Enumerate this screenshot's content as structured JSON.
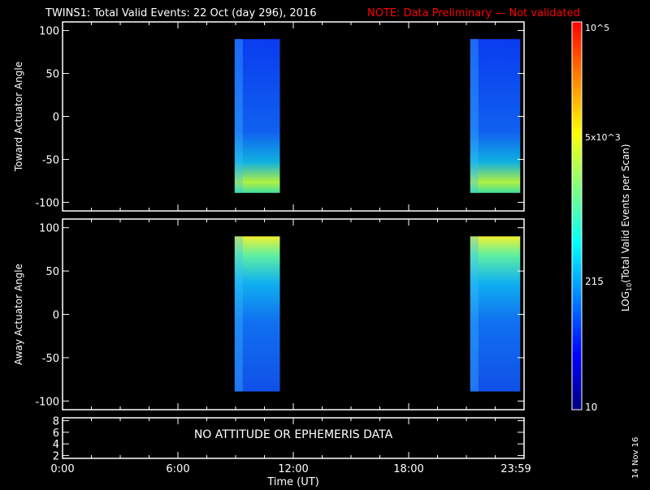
{
  "title": "TWINS1: Total Valid Events: 22 Oct (day 296), 2016",
  "note": "NOTE: Data Preliminary — Not validated",
  "date_stamp": "14 Nov 16",
  "chart_data": [
    {
      "type": "heatmap",
      "ylabel": "Toward Actuator Angle",
      "ylim": [
        -110,
        110
      ],
      "yticks": [
        "100",
        "50",
        "0",
        "-50",
        "-100"
      ],
      "ytick_values": [
        100,
        50,
        0,
        -50,
        -100
      ],
      "blocks": [
        {
          "t0": 8.95,
          "t1": 11.3,
          "a0": -89,
          "a1": 90,
          "profile": "bottom-bright"
        },
        {
          "t0": 21.2,
          "t1": 23.8,
          "a0": -89,
          "a1": 90,
          "profile": "bottom-bright"
        }
      ]
    },
    {
      "type": "heatmap",
      "ylabel": "Away Actuator Angle",
      "ylim": [
        -110,
        110
      ],
      "yticks": [
        "100",
        "50",
        "0",
        "-50",
        "-100"
      ],
      "ytick_values": [
        100,
        50,
        0,
        -50,
        -100
      ],
      "blocks": [
        {
          "t0": 8.95,
          "t1": 11.3,
          "a0": -89,
          "a1": 90,
          "profile": "top-bright"
        },
        {
          "t0": 21.2,
          "t1": 23.8,
          "a0": -89,
          "a1": 90,
          "profile": "top-bright"
        }
      ]
    },
    {
      "type": "text-panel",
      "ylim": [
        1.5,
        8.5
      ],
      "yticks": [
        "8",
        "6",
        "4",
        "2"
      ],
      "ytick_values": [
        8,
        6,
        4,
        2
      ],
      "message": "NO ATTITUDE OR EPHEMERIS DATA"
    }
  ],
  "xaxis": {
    "label": "Time (UT)",
    "ticks": [
      "0:00",
      "6:00",
      "12:00",
      "18:00",
      "23:59"
    ],
    "tick_values": [
      0,
      6,
      12,
      18,
      23.98
    ],
    "xlim": [
      0,
      24
    ]
  },
  "colorbar": {
    "label": "LOG10(Total Valid Events per Scan)",
    "label_main": "LOG",
    "label_sub": "10",
    "label_rest": "(Total Valid Events per Scan)",
    "ticks": [
      "10",
      "215",
      "5x10^3",
      "10^5"
    ],
    "tick_labels": {
      "t10": "10",
      "t215": "215",
      "t5k_base": "5x",
      "t5k_ten": "10",
      "t5k_exp": "3",
      "t1e5_ten": "10",
      "t1e5_exp": "5"
    },
    "colors": [
      "#00007f",
      "#0000ff",
      "#0080ff",
      "#00ffff",
      "#80ff80",
      "#ffff00",
      "#ff8000",
      "#ff0000"
    ]
  },
  "colors": {
    "title": "#ffffff",
    "note": "#ff0000",
    "frame": "#ffffff"
  }
}
